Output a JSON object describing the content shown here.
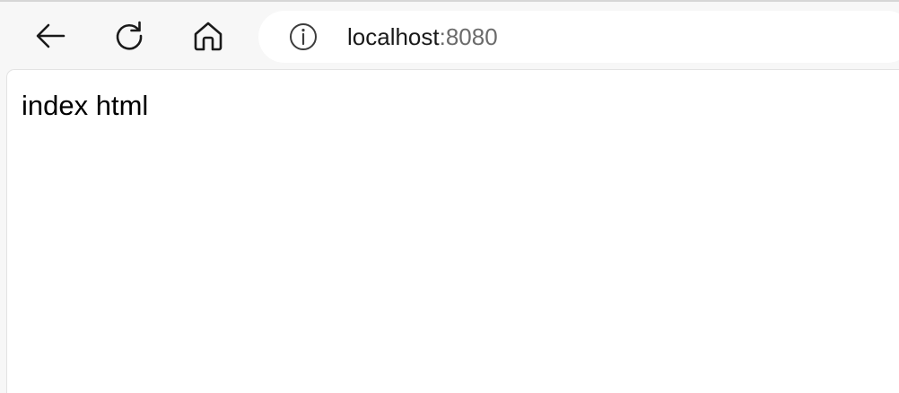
{
  "browser": {
    "toolbar": {
      "back_icon": "arrow-left-icon",
      "reload_icon": "refresh-icon",
      "home_icon": "home-icon"
    },
    "address_bar": {
      "info_icon": "info-icon",
      "host": "localhost",
      "port": ":8080"
    }
  },
  "page": {
    "body_text": "index html"
  },
  "colors": {
    "toolbar_bg": "#f7f7f7",
    "address_bg": "#ffffff",
    "port_text": "#6b6b6b",
    "host_text": "#1a1a1a"
  }
}
